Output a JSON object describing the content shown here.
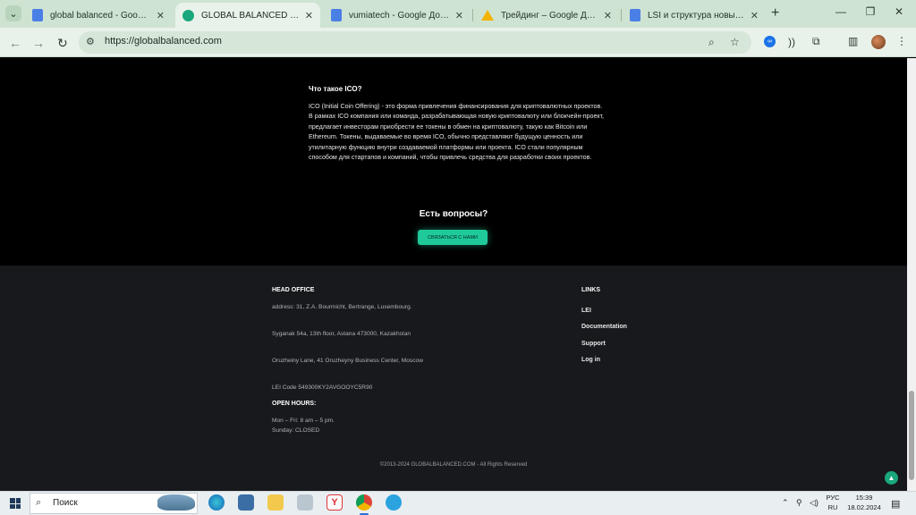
{
  "browser": {
    "tabs": [
      {
        "title": "global balanced - Google Доку",
        "favicon": "docs-icon",
        "active": false
      },
      {
        "title": "GLOBAL BALANCED FUND - Уп",
        "favicon": "gbf-icon",
        "active": true
      },
      {
        "title": "vumiatech - Google Документ",
        "favicon": "docs-icon",
        "active": false
      },
      {
        "title": "Трейдинг – Google Диск",
        "favicon": "drive-icon",
        "active": false
      },
      {
        "title": "LSI и структура новые - Googl",
        "favicon": "docs-icon",
        "active": false
      }
    ],
    "url": "https://globalbalanced.com"
  },
  "faq": {
    "question": "Что такое ICO?",
    "answer": "ICO (Initial Coin Offering) - это форма привлечения финансирования для криптовалютных проектов. В рамках ICO компания или команда, разрабатывающая новую криптовалюту или блокчейн-проект, предлагает инвесторам приобрести ее токены в обмен на криптовалюту, такую как Bitcoin или Ethereum. Токены, выдаваемые во время ICO, обычно представляют будущую ценность или утилитарную функцию внутри создаваемой платформы или проекта. ICO стали популярным способом для стартапов и компаний, чтобы привлечь средства для разработки своих проектов."
  },
  "contact": {
    "heading": "Есть вопросы?",
    "button": "СВЯЗАТЬСЯ С НАМИ"
  },
  "footer": {
    "head_office_title": "HEAD OFFICE",
    "address_1": "address: 31, Z.A. Bourmicht, Bertrange, Luxembourg.",
    "address_2": "Syganak 54a, 13th floor, Astana 473000, Kazakhstan",
    "address_3": "Oruzheiny Lane, 41 Oruzheyny Business Center, Moscow",
    "lei_code": "LEI Code 549300KY2AVGOOYC5R90",
    "open_hours_title": "OPEN HOURS:",
    "hours_weekday": "Mon – Fri: 8 am – 5 pm.",
    "hours_sunday": "Sunday: CLOSED",
    "links_title": "LINKS",
    "links": [
      "LEI",
      "Documentation",
      "Support",
      "Log in"
    ],
    "copyright": "©2013-2024 GLOBALBALANCED.COM - All Rights Reserved"
  },
  "taskbar": {
    "search_label": "Поиск",
    "lang_top": "РУС",
    "lang_bottom": "RU",
    "time": "15:39",
    "date": "18.02.2024"
  },
  "colors": {
    "accent": "#1fc99a",
    "footer_bg": "#17191c",
    "page_bg": "#000000",
    "chrome_tabstrip": "#cfe3d2"
  }
}
